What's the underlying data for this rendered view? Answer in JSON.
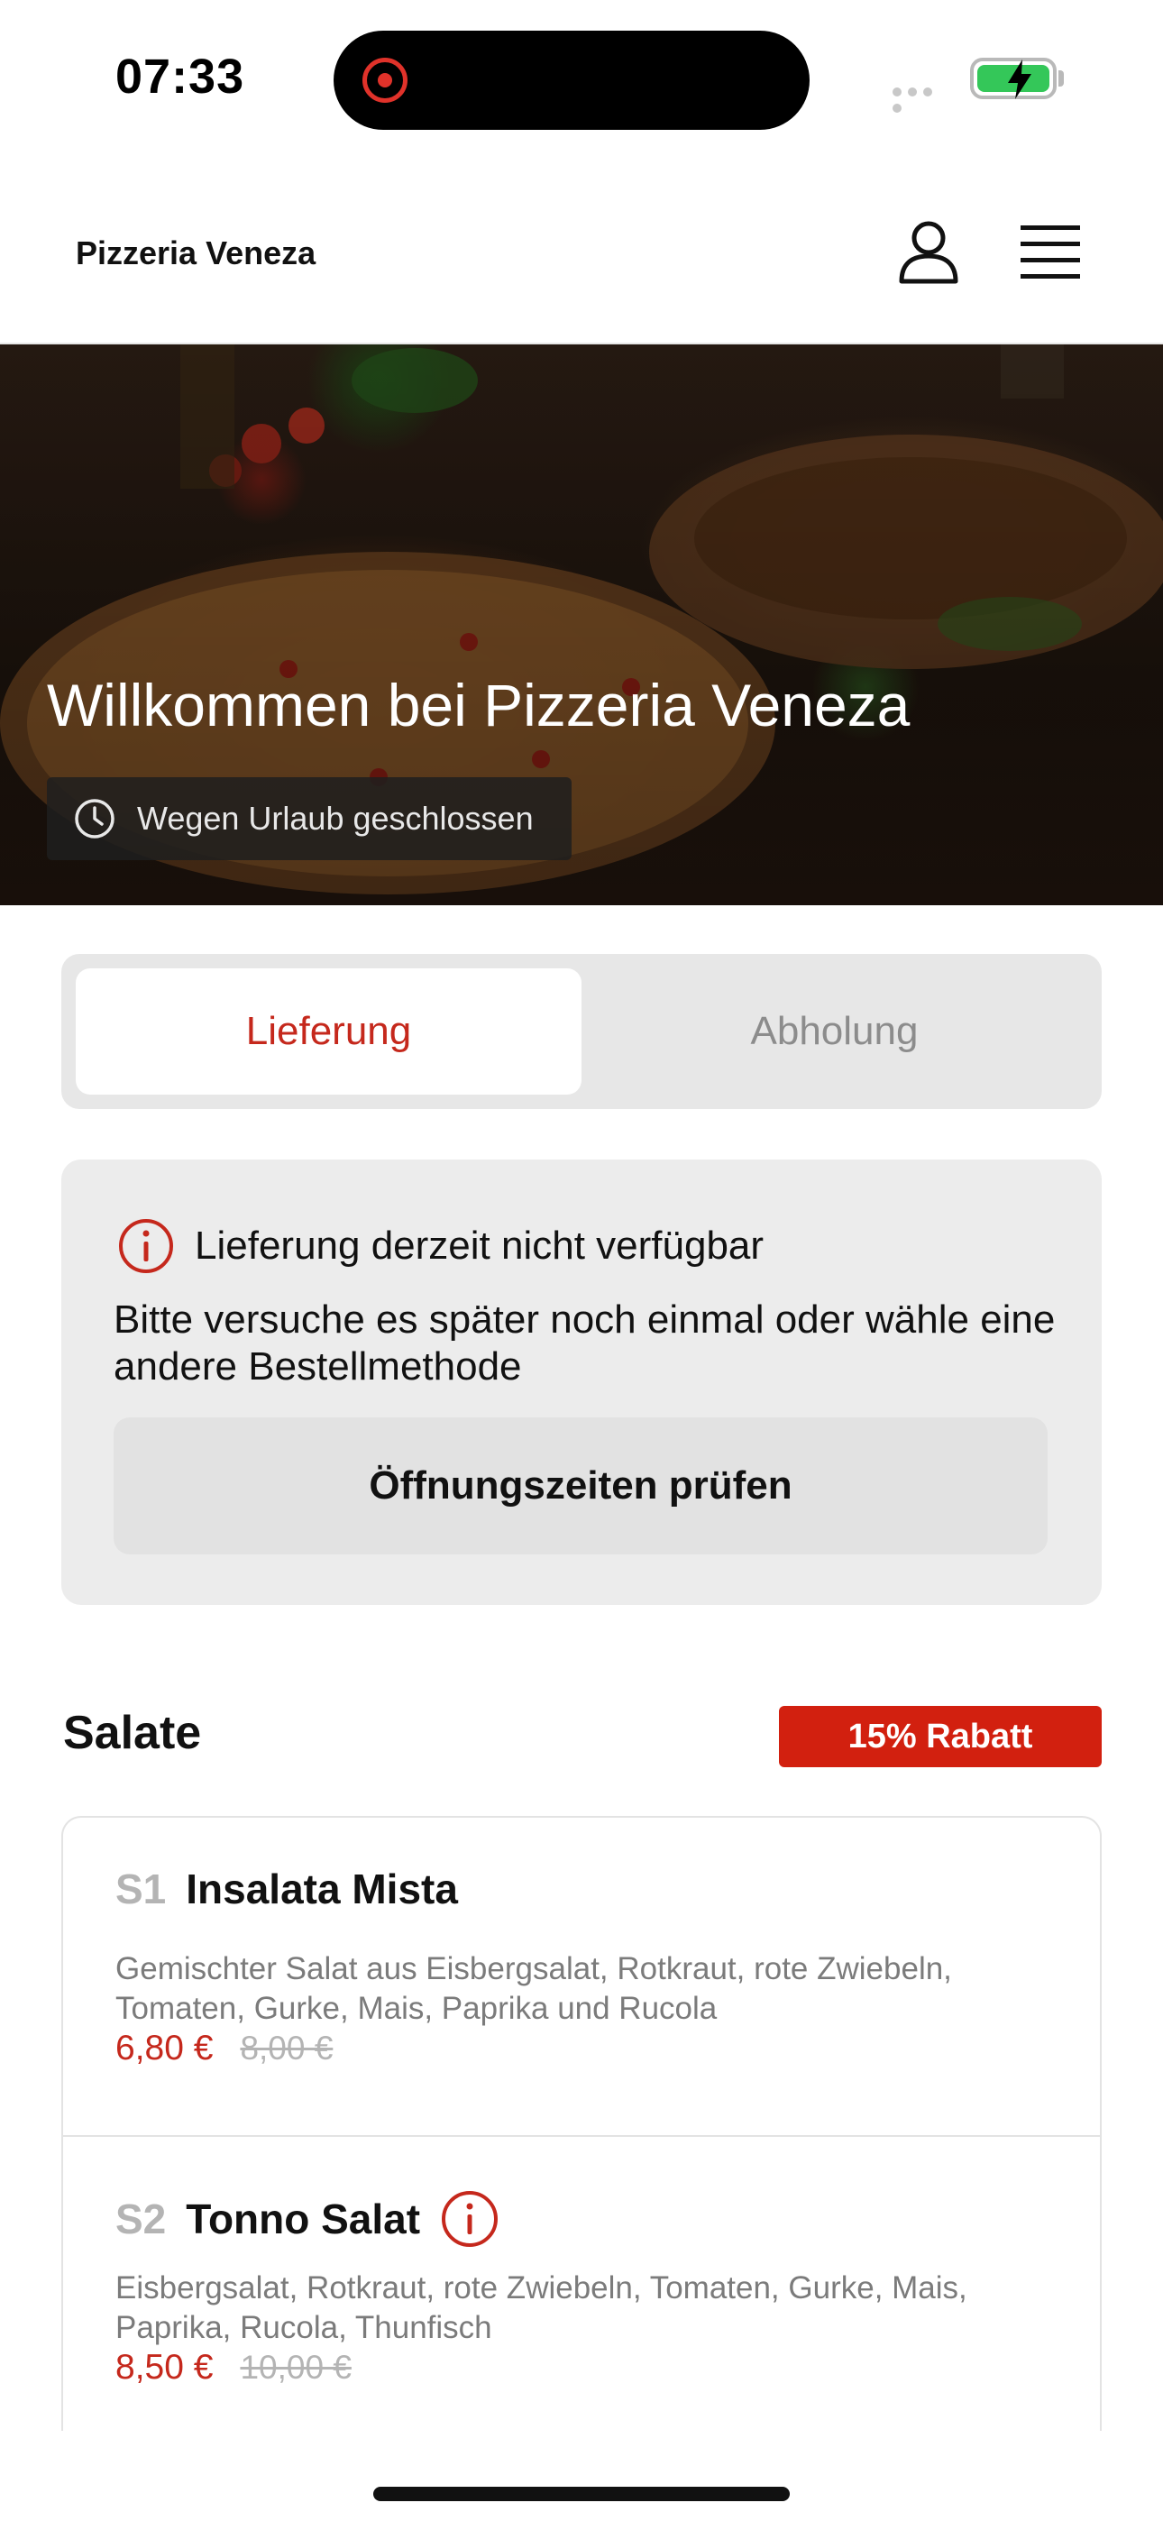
{
  "status_bar": {
    "time": "07:33"
  },
  "header": {
    "brand": "Pizzeria Veneza",
    "icons": [
      "user-icon",
      "menu-icon"
    ]
  },
  "hero": {
    "title": "Willkommen bei Pizzeria Veneza",
    "status_text": "Wegen Urlaub geschlossen",
    "status_icon": "clock-icon"
  },
  "order_mode": {
    "options": [
      {
        "label": "Lieferung",
        "selected": true
      },
      {
        "label": "Abholung",
        "selected": false
      }
    ]
  },
  "notice": {
    "icon": "info-icon",
    "title": "Lieferung derzeit nicht verfügbar",
    "body": "Bitte versuche es später noch einmal oder wähle eine andere Bestellmethode",
    "button_label": "Öffnungszeiten prüfen"
  },
  "section": {
    "title": "Salate",
    "discount": "15% Rabatt"
  },
  "products": [
    {
      "code": "S1",
      "name": "Insalata Mista",
      "has_info": false,
      "description": "Gemischter Salat aus Eisbergsalat, Rotkraut, rote Zwiebeln, Tomaten, Gurke, Mais, Paprika und Rucola",
      "price": "6,80 €",
      "old_price": "8,00 €"
    },
    {
      "code": "S2",
      "name": "Tonno Salat",
      "has_info": true,
      "description": "Eisbergsalat, Rotkraut, rote Zwiebeln, Tomaten, Gurke, Mais, Paprika, Rucola, Thunfisch",
      "price": "8,50 €",
      "old_price": "10,00 €"
    }
  ],
  "colors": {
    "accent_red": "#c5281c",
    "badge_red": "#d2200f",
    "battery_green": "#34c759"
  }
}
